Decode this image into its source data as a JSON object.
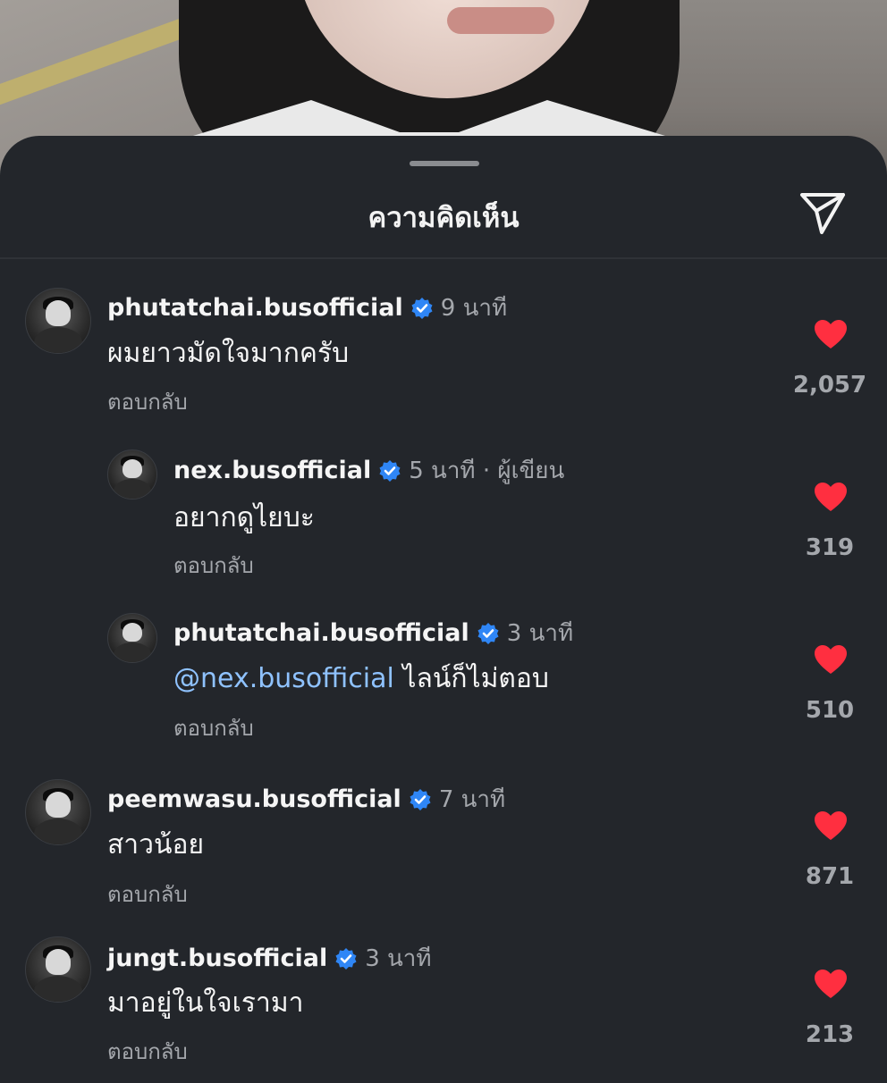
{
  "sheet": {
    "title": "ความคิดเห็น",
    "send_icon": "send-icon"
  },
  "colors": {
    "background": "#23262b",
    "text_primary": "#f5f5f5",
    "text_secondary": "#a4a7ac",
    "verified_blue": "#2f86f6",
    "like_red": "#ff2f40",
    "mention": "#8fc2ff"
  },
  "comments": [
    {
      "username": "phutatchai.busofficial",
      "time": "9 นาที",
      "text": "ผมยาวมัดใจมากครับ",
      "reply_label": "ตอบกลับ",
      "likes": "2,057"
    },
    {
      "username": "nex.busofficial",
      "time": "5 นาที · ผู้เขียน",
      "text": "อยากดูไยบะ",
      "reply_label": "ตอบกลับ",
      "likes": "319"
    },
    {
      "username": "phutatchai.busofficial",
      "time": "3 นาที",
      "mention": "@nex.busofficial",
      "text": "ไลน์ก็ไม่ตอบ",
      "reply_label": "ตอบกลับ",
      "likes": "510"
    },
    {
      "username": "peemwasu.busofficial",
      "time": "7 นาที",
      "text": "สาวน้อย",
      "reply_label": "ตอบกลับ",
      "likes": "871"
    },
    {
      "username": "jungt.busofficial",
      "time": "3 นาที",
      "text": "มาอยู่ในใจเรามา",
      "reply_label": "ตอบกลับ",
      "likes": "213"
    }
  ]
}
